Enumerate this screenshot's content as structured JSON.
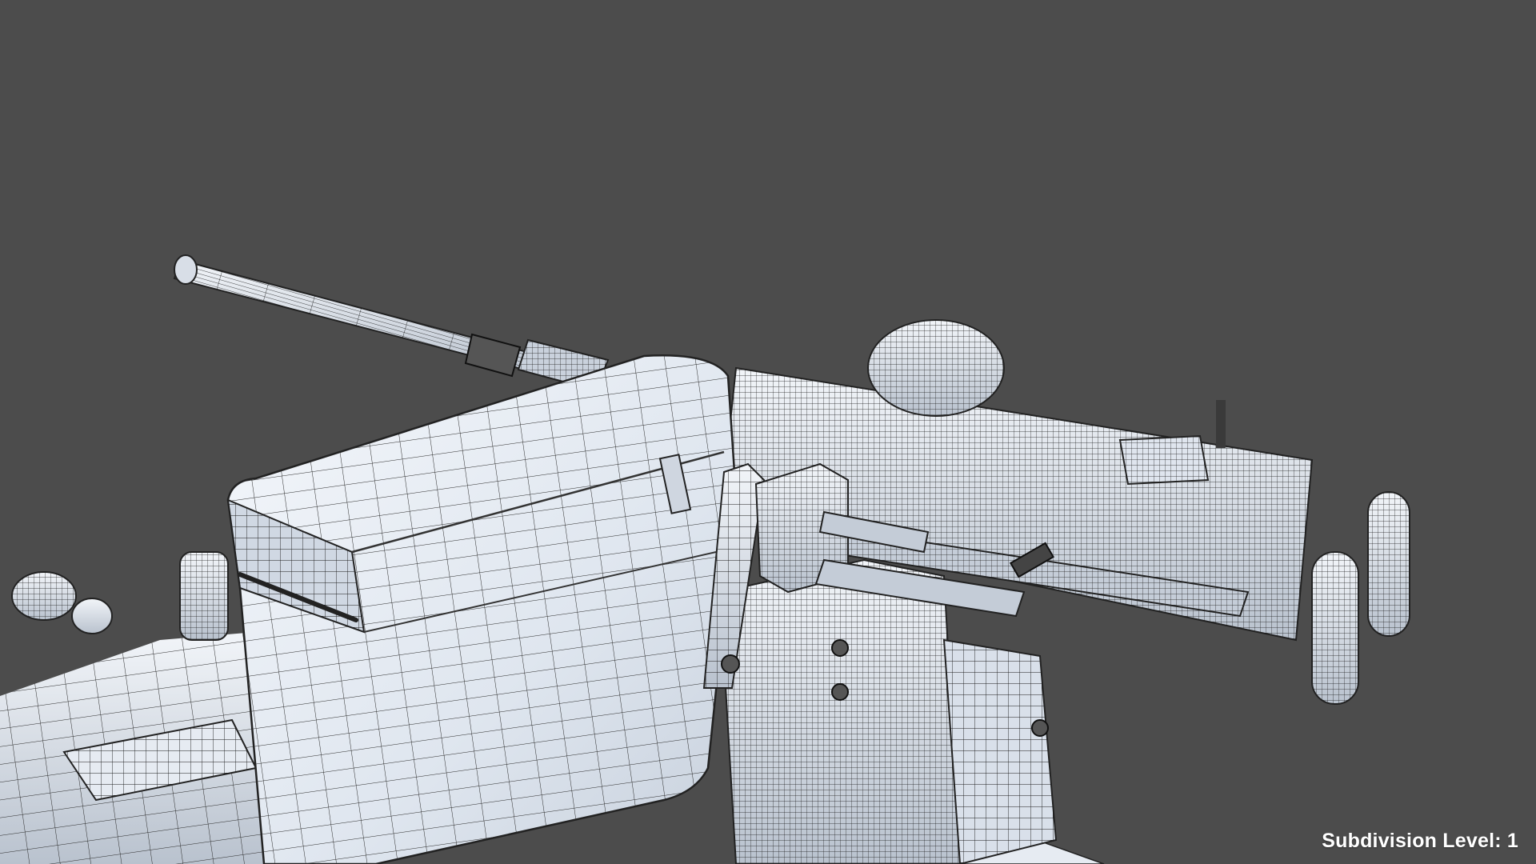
{
  "viewport": {
    "background_color": "#4c4c4c",
    "model_base_color": "#e9eef5",
    "wire_color": "#1a1a1a",
    "shadow_color": "#9aa4b2"
  },
  "overlay": {
    "subdivision_label": "Subdivision Level: 1"
  }
}
